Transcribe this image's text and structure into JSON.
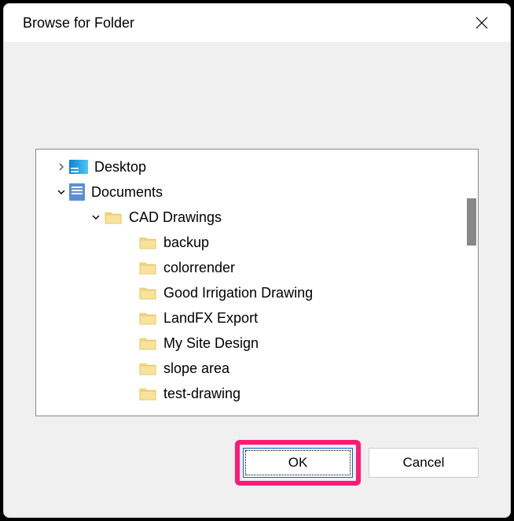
{
  "dialog": {
    "title": "Browse for Folder"
  },
  "tree": {
    "nodes": [
      {
        "label": "Desktop",
        "level": 0,
        "icon": "desktop",
        "expander": "right"
      },
      {
        "label": "Documents",
        "level": 0,
        "icon": "documents",
        "expander": "down"
      },
      {
        "label": "CAD Drawings",
        "level": 1,
        "icon": "folder",
        "expander": "down"
      },
      {
        "label": "backup",
        "level": 2,
        "icon": "folder",
        "expander": "none"
      },
      {
        "label": "colorrender",
        "level": 2,
        "icon": "folder",
        "expander": "none"
      },
      {
        "label": "Good Irrigation Drawing",
        "level": 2,
        "icon": "folder",
        "expander": "none"
      },
      {
        "label": "LandFX Export",
        "level": 2,
        "icon": "folder",
        "expander": "none"
      },
      {
        "label": "My Site Design",
        "level": 2,
        "icon": "folder",
        "expander": "none"
      },
      {
        "label": "slope area",
        "level": 2,
        "icon": "folder",
        "expander": "none"
      },
      {
        "label": "test-drawing",
        "level": 2,
        "icon": "folder",
        "expander": "none"
      }
    ]
  },
  "buttons": {
    "ok": "OK",
    "cancel": "Cancel"
  },
  "highlight": "ok"
}
